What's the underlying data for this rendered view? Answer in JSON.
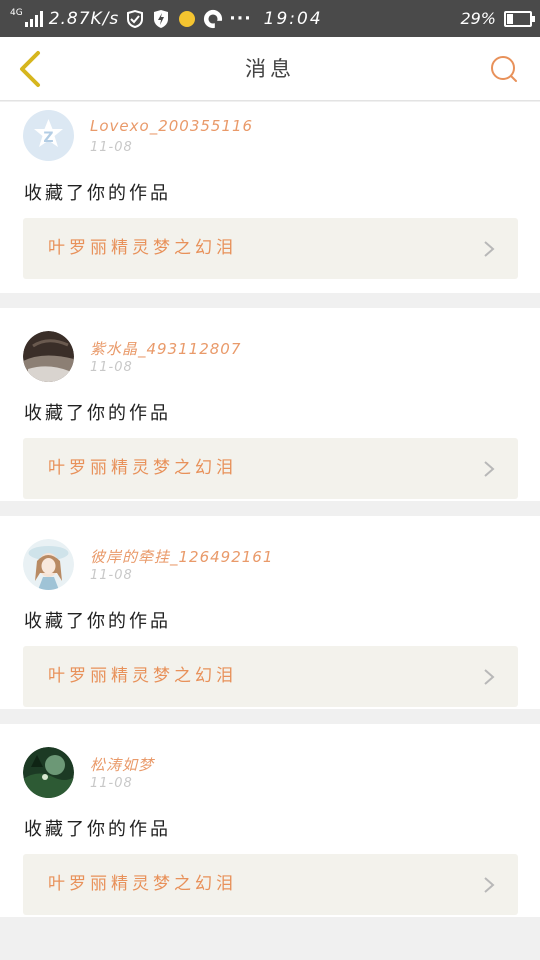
{
  "status_bar": {
    "network": "4G",
    "speed": "2.87K/s",
    "time": "19:04",
    "battery": "29%",
    "battery_level": 0.29,
    "icons": [
      "signal-icon",
      "check-shield-icon",
      "lightning-icon",
      "yellow-dot-icon",
      "app-icon",
      "more-dots-icon",
      "battery-icon"
    ]
  },
  "header": {
    "title": "消息",
    "back_icon": "chevron-left-icon",
    "search_icon": "search-icon",
    "accent": "#e8915a",
    "back_color": "#d6b61e"
  },
  "messages": [
    {
      "user": "Lovexo_200355116",
      "date": "11-08",
      "action": "收藏了你的作品",
      "work": "叶罗丽精灵梦之幻泪",
      "avatar": "qq-default-avatar"
    },
    {
      "user": "紫水晶_493112807",
      "date": "11-08",
      "action": "收藏了你的作品",
      "work": "叶罗丽精灵梦之幻泪",
      "avatar": "user-avatar-photo"
    },
    {
      "user": "彼岸的牵挂_126492161",
      "date": "11-08",
      "action": "收藏了你的作品",
      "work": "叶罗丽精灵梦之幻泪",
      "avatar": "anime-girl-avatar"
    },
    {
      "user": "松涛如梦",
      "date": "11-08",
      "action": "收藏了你的作品",
      "work": "叶罗丽精灵梦之幻泪",
      "avatar": "forest-avatar"
    }
  ]
}
